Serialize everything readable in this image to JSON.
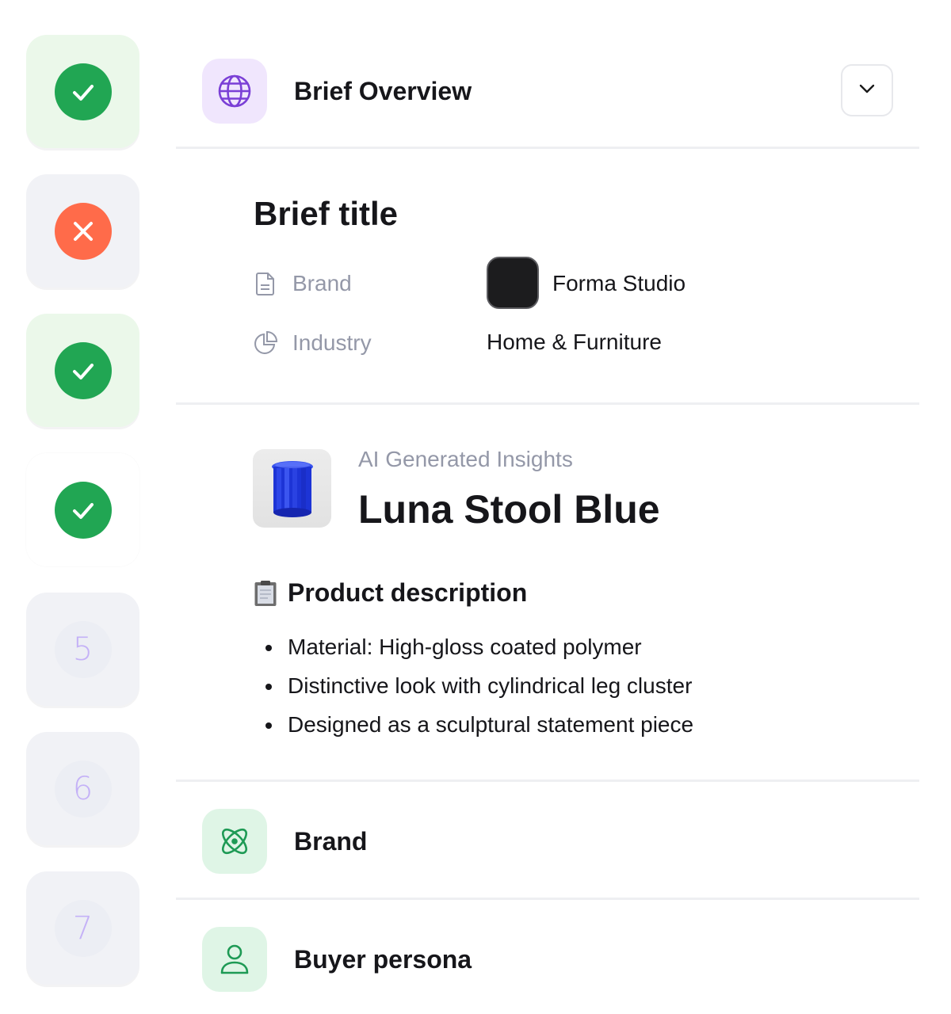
{
  "stepper": {
    "steps": [
      {
        "state": "done",
        "icon": "check-icon"
      },
      {
        "state": "error",
        "icon": "close-icon"
      },
      {
        "state": "done",
        "icon": "check-icon"
      },
      {
        "state": "active",
        "icon": "check-icon"
      },
      {
        "state": "pending",
        "number": "5"
      },
      {
        "state": "pending",
        "number": "6"
      },
      {
        "state": "pending",
        "number": "7"
      }
    ]
  },
  "overview": {
    "title": "Brief Overview",
    "icon": "globe-icon",
    "toggle_icon": "chevron-down-icon"
  },
  "brief": {
    "title": "Brief title",
    "fields": [
      {
        "label": "Brand",
        "icon": "document-icon",
        "value": "Forma Studio"
      },
      {
        "label": "Industry",
        "icon": "pie-chart-icon",
        "value": "Home & Furniture"
      }
    ]
  },
  "insights": {
    "label": "AI Generated Insights",
    "product_name": "Luna Stool Blue",
    "description_title": "Product description",
    "description_icon": "clipboard-icon",
    "bullets": [
      "Material: High-gloss coated polymer",
      "Distinctive look with cylindrical leg cluster",
      "Designed as a sculptural statement piece"
    ]
  },
  "sections": [
    {
      "title": "Brand",
      "icon": "atom-icon"
    },
    {
      "title": "Buyer persona",
      "icon": "user-icon"
    }
  ],
  "colors": {
    "success": "#21a653",
    "error": "#ff6b4a",
    "accent_purple": "#7a3fd6",
    "accent_green": "#1e9a55",
    "muted_text": "#9498a8"
  }
}
